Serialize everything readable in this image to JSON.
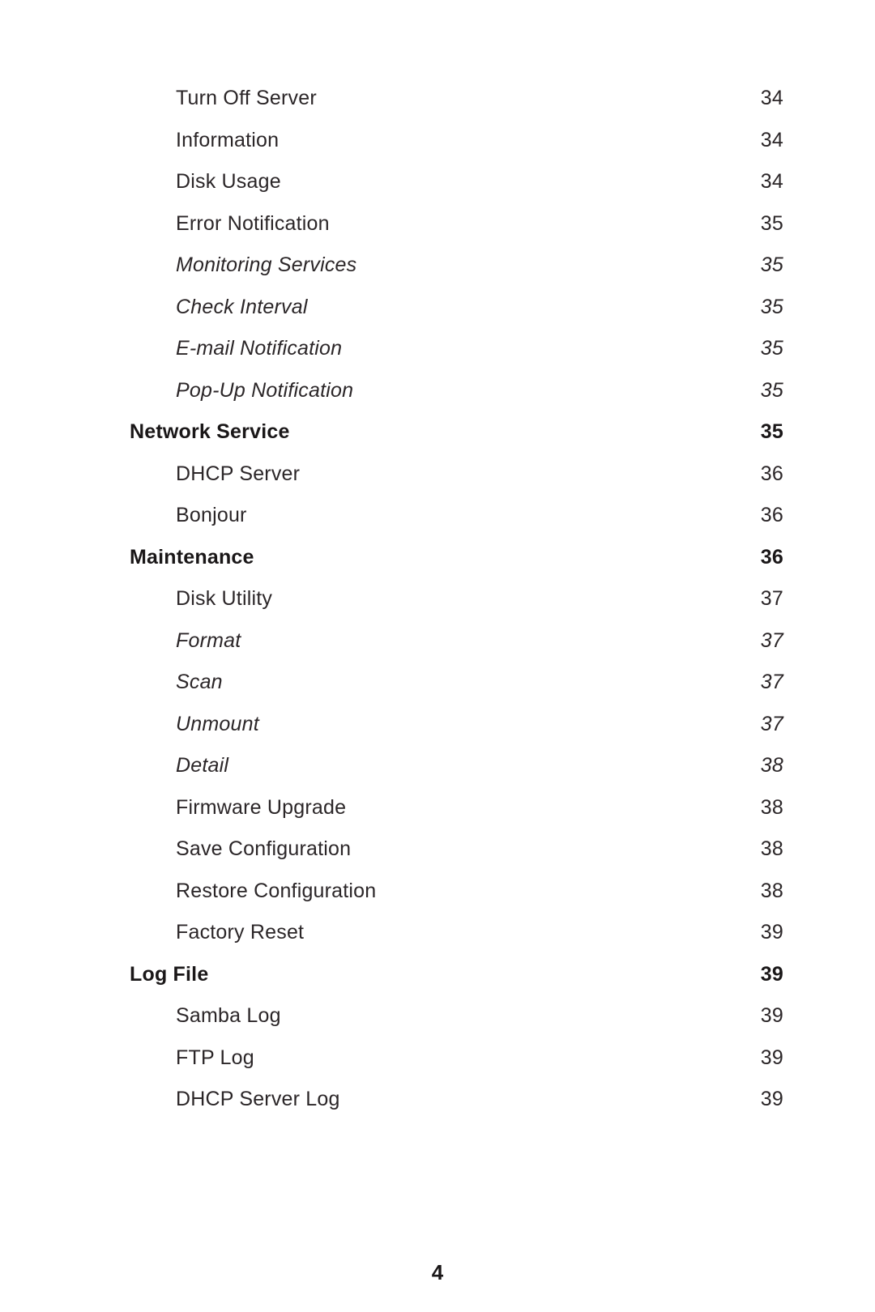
{
  "toc": {
    "entries": [
      {
        "title": "Turn Off Server",
        "page": "34",
        "level": 2,
        "style": "normal"
      },
      {
        "title": "Information",
        "page": "34",
        "level": 2,
        "style": "normal"
      },
      {
        "title": "Disk Usage",
        "page": "34",
        "level": 2,
        "style": "normal"
      },
      {
        "title": "Error Notification",
        "page": "35",
        "level": 2,
        "style": "normal"
      },
      {
        "title": "Monitoring Services",
        "page": "35",
        "level": 3,
        "style": "italic"
      },
      {
        "title": "Check Interval",
        "page": "35",
        "level": 3,
        "style": "italic"
      },
      {
        "title": "E-mail Notification",
        "page": "35",
        "level": 3,
        "style": "italic"
      },
      {
        "title": "Pop-Up Notification",
        "page": "35",
        "level": 3,
        "style": "italic"
      },
      {
        "title": "Network Service",
        "page": "35",
        "level": 1,
        "style": "bold"
      },
      {
        "title": "DHCP Server",
        "page": "36",
        "level": 2,
        "style": "normal"
      },
      {
        "title": "Bonjour",
        "page": "36",
        "level": 2,
        "style": "normal"
      },
      {
        "title": "Maintenance",
        "page": "36",
        "level": 1,
        "style": "bold"
      },
      {
        "title": "Disk Utility",
        "page": "37",
        "level": 2,
        "style": "normal"
      },
      {
        "title": "Format",
        "page": "37",
        "level": 3,
        "style": "italic"
      },
      {
        "title": "Scan",
        "page": "37",
        "level": 3,
        "style": "italic"
      },
      {
        "title": "Unmount",
        "page": "37",
        "level": 3,
        "style": "italic"
      },
      {
        "title": "Detail",
        "page": "38",
        "level": 3,
        "style": "italic"
      },
      {
        "title": "Firmware Upgrade",
        "page": "38",
        "level": 2,
        "style": "normal"
      },
      {
        "title": "Save Configuration",
        "page": "38",
        "level": 2,
        "style": "normal"
      },
      {
        "title": "Restore Configuration",
        "page": "38",
        "level": 2,
        "style": "normal"
      },
      {
        "title": "Factory Reset",
        "page": "39",
        "level": 2,
        "style": "normal"
      },
      {
        "title": "Log File",
        "page": "39",
        "level": 1,
        "style": "bold"
      },
      {
        "title": "Samba Log",
        "page": "39",
        "level": 2,
        "style": "normal"
      },
      {
        "title": "FTP Log",
        "page": "39",
        "level": 2,
        "style": "normal"
      },
      {
        "title": "DHCP Server Log",
        "page": "39",
        "level": 2,
        "style": "normal"
      }
    ]
  },
  "footer": {
    "page_number": "4"
  }
}
